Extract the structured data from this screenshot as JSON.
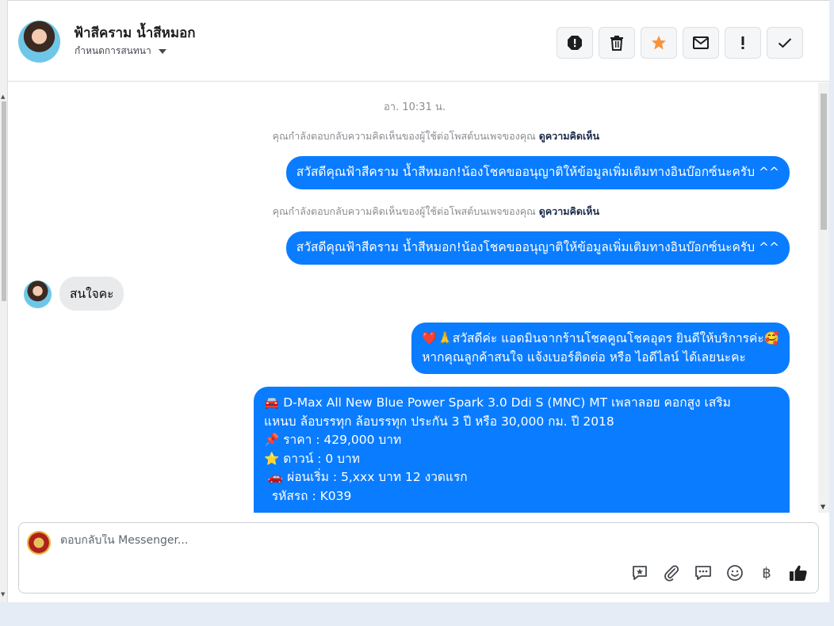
{
  "header": {
    "contact_name": "ฟ้าสีคราม น้ำสีหมอก",
    "assign_label": "กำหนดการสนทนา",
    "actions": [
      {
        "name": "report-icon"
      },
      {
        "name": "trash-icon"
      },
      {
        "name": "star-icon"
      },
      {
        "name": "mail-icon"
      },
      {
        "name": "exclamation-icon"
      },
      {
        "name": "check-icon"
      }
    ],
    "star_color": "#f7923b"
  },
  "conversation": {
    "timestamp": "อา. 10:31 น.",
    "notices": [
      {
        "text": "คุณกำลังตอบกลับความคิดเห็นของผู้ใช้ต่อโพสต์บนเพจของคุณ",
        "link": "ดูความคิดเห็น"
      },
      {
        "text": "คุณกำลังตอบกลับความคิดเห็นของผู้ใช้ต่อโพสต์บนเพจของคุณ",
        "link": "ดูความคิดเห็น"
      }
    ],
    "outgoing_1": "สวัสดีคุณฟ้าสีคราม น้ำสีหมอก!น้องโชคขออนุญาติให้ข้อมูลเพิ่มเติมทางอินบ๊อกซ์นะครับ ^^",
    "outgoing_2": "สวัสดีคุณฟ้าสีคราม น้ำสีหมอก!น้องโชคขออนุญาติให้ข้อมูลเพิ่มเติมทางอินบ๊อกซ์นะครับ ^^",
    "incoming_1": "สนใจคะ",
    "outgoing_3": {
      "line1": "❤️🙏สวัสดีค่ะ แอดมินจากร้านโชคคูณโชคอุดร ยินดีให้บริการค่ะ🥰",
      "line2": "หากคุณลูกค้าสนใจ แจ้งเบอร์ติดต่อ หรือ ไอดีไลน์ ได้เลยนะคะ"
    },
    "outgoing_4": {
      "line1": "🚘 D-Max All New Blue Power Spark 3.0 Ddi S (MNC) MT เพลาลอย คอกสูง เสริม",
      "line2": "แหนบ ล้อบรรทุก ล้อบรรทุก ประกัน 3 ปี หรือ 30,000 กม. ปี 2018",
      "line3": "📌 ราคา : 429,000 บาท",
      "line4": "⭐ ดาวน์ : 0 บาท",
      "line5": " 🚗 ผ่อนเริ่ม : 5,xxx บาท 12 งวดแรก",
      "line6": "  รหัสรถ : K039"
    },
    "bubble_color": "#0a7cff"
  },
  "composer": {
    "placeholder": "ตอบกลับใน Messenger...",
    "tools": [
      {
        "name": "saved-reply-icon"
      },
      {
        "name": "attachment-icon"
      },
      {
        "name": "chat-bubble-icon"
      },
      {
        "name": "emoji-icon"
      },
      {
        "name": "baht-icon",
        "glyph": "฿"
      },
      {
        "name": "thumbs-up-icon"
      }
    ]
  }
}
